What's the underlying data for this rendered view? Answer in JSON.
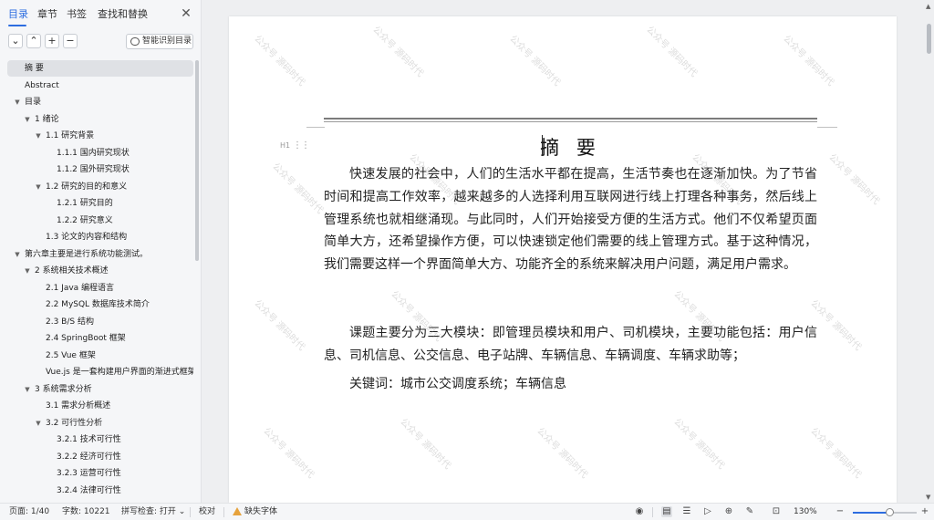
{
  "sidebar": {
    "tabs": [
      {
        "label": "目录",
        "active": true
      },
      {
        "label": "章节",
        "active": false
      },
      {
        "label": "书签",
        "active": false
      },
      {
        "label": "查找和替换",
        "active": false
      }
    ],
    "close_icon": "close-icon",
    "tools": {
      "collapse_icon": "chevron-down-icon",
      "expand_icon": "chevron-up-icon",
      "add_icon": "plus-icon",
      "remove_icon": "minus-icon",
      "smart_label": "智能识别目录"
    },
    "toc": [
      {
        "label": "摘  要",
        "level": 0,
        "arrow": false,
        "selected": true
      },
      {
        "label": "Abstract",
        "level": 0,
        "arrow": false
      },
      {
        "label": "目录",
        "level": 0,
        "arrow": true
      },
      {
        "label": "1 绪论",
        "level": 1,
        "arrow": true
      },
      {
        "label": "1.1  研究背景",
        "level": 2,
        "arrow": true
      },
      {
        "label": "1.1.1 国内研究现状",
        "level": 3,
        "arrow": false
      },
      {
        "label": "1.1.2 国外研究现状",
        "level": 3,
        "arrow": false
      },
      {
        "label": "1.2 研究的目的和意义",
        "level": 2,
        "arrow": true
      },
      {
        "label": "1.2.1 研究目的",
        "level": 3,
        "arrow": false
      },
      {
        "label": "1.2.2  研究意义",
        "level": 3,
        "arrow": false
      },
      {
        "label": "1.3  论文的内容和结构",
        "level": 2,
        "arrow": false
      },
      {
        "label": "第六章主要是进行系统功能测试。",
        "level": 0,
        "arrow": true
      },
      {
        "label": "2 系统相关技术概述",
        "level": 1,
        "arrow": true
      },
      {
        "label": "2.1 Java 编程语言",
        "level": 2,
        "arrow": false
      },
      {
        "label": "2.2 MySQL 数据库技术简介",
        "level": 2,
        "arrow": false
      },
      {
        "label": "2.3 B/S 结构",
        "level": 2,
        "arrow": false
      },
      {
        "label": "2.4 SpringBoot 框架",
        "level": 2,
        "arrow": false
      },
      {
        "label": "2.5 Vue 框架",
        "level": 2,
        "arrow": false
      },
      {
        "label": "Vue.js 是一套构建用户界面的渐进式框架...",
        "level": 2,
        "arrow": false
      },
      {
        "label": "3 系统需求分析",
        "level": 1,
        "arrow": true
      },
      {
        "label": "3.1 需求分析概述",
        "level": 2,
        "arrow": false
      },
      {
        "label": "3.2 可行性分析",
        "level": 2,
        "arrow": true
      },
      {
        "label": "3.2.1 技术可行性",
        "level": 3,
        "arrow": false
      },
      {
        "label": "3.2.2 经济可行性",
        "level": 3,
        "arrow": false
      },
      {
        "label": "3.2.3 运营可行性",
        "level": 3,
        "arrow": false
      },
      {
        "label": "3.2.4 法律可行性",
        "level": 3,
        "arrow": false
      }
    ]
  },
  "document": {
    "heading_marker": "H1",
    "title": "摘  要",
    "paragraphs": [
      "快速发展的社会中，人们的生活水平都在提高，生活节奏也在逐渐加快。为了节省时间和提高工作效率，越来越多的人选择利用互联网进行线上打理各种事务，然后线上管理系统也就相继涌现。与此同时，人们开始接受方便的生活方式。他们不仅希望页面简单大方，还希望操作方便，可以快速锁定他们需要的线上管理方式。基于这种情况，我们需要这样一个界面简单大方、功能齐全的系统来解决用户问题，满足用户需求。",
      "课题主要分为三大模块：即管理员模块和用户、司机模块，主要功能包括：用户信息、司机信息、公交信息、电子站牌、车辆信息、车辆调度、车辆求助等；",
      "关键词：城市公交调度系统；车辆信息"
    ],
    "watermark": "公众号 源码时代"
  },
  "statusbar": {
    "page": "页面: 1/40",
    "words": "字数: 10221",
    "spellcheck": "拼写检查: 打开",
    "proofread": "校对",
    "missing_font": "缺失字体",
    "zoom": "130%",
    "zoom_fraction": 0.57,
    "icons": [
      "eye-icon",
      "page-view-icon",
      "outline-view-icon",
      "play-icon",
      "web-icon",
      "pen-icon",
      "fit-icon",
      "zoom-out-icon",
      "zoom-in-icon"
    ]
  }
}
